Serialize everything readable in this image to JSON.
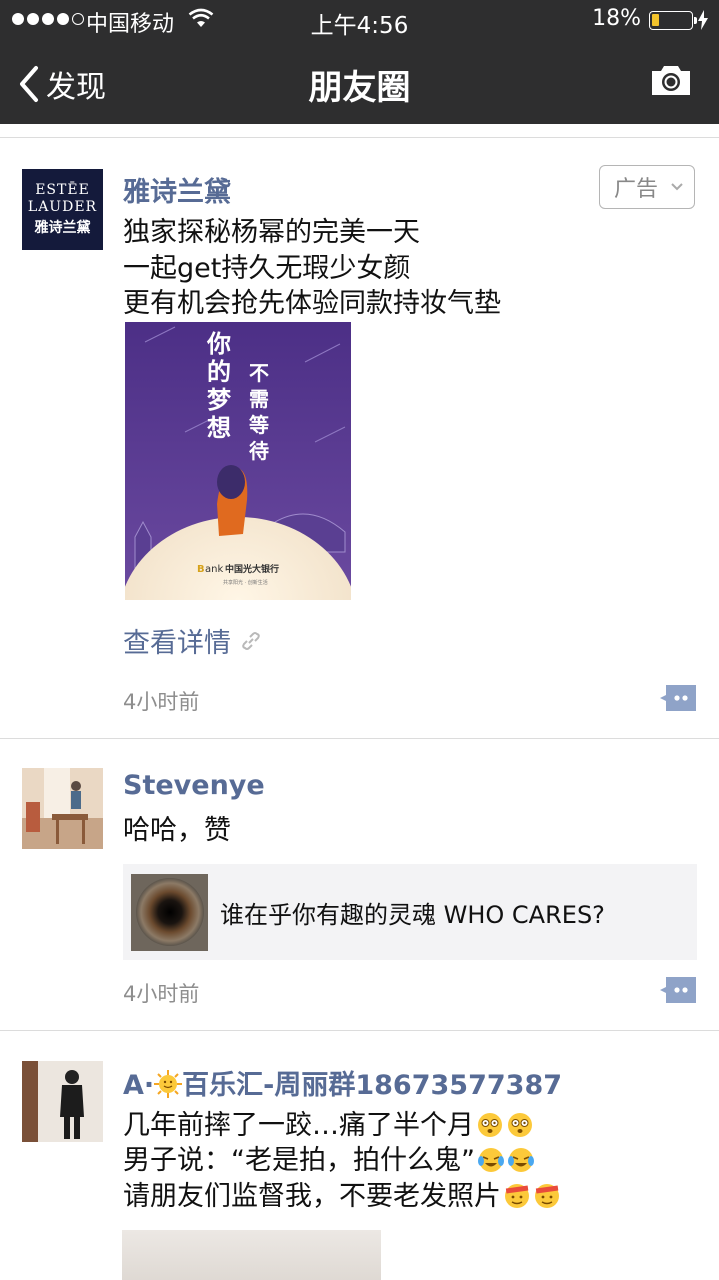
{
  "status_bar": {
    "carrier": "中国移动",
    "time": "上午4:56",
    "battery_percent": "18%",
    "battery_level": 0.18
  },
  "nav": {
    "back_label": "发现",
    "title": "朋友圈"
  },
  "posts": [
    {
      "author": "雅诗兰黛",
      "avatar_text": [
        "ESTĒE",
        "LAUDER",
        "雅诗兰黛"
      ],
      "badge": "广告",
      "lines": [
        "独家探秘杨幂的完美一天",
        "一起get持久无瑕少女颜",
        "更有机会抢先体验同款持妆气垫"
      ],
      "image": {
        "left_text": "你的梦想",
        "right_text": "不需等待",
        "bank_text": "ank",
        "bank_name": "中国光大银行",
        "bank_slogan": "共享阳光 · 创新生活"
      },
      "link_label": "查看详情",
      "time_ago": "4小时前"
    },
    {
      "author": "Stevenye",
      "lines": [
        "哈哈，赞"
      ],
      "share_title": "谁在乎你有趣的灵魂 WHO CARES?",
      "time_ago": "4小时前"
    },
    {
      "author_prefix": "A·",
      "author_suffix": "百乐汇-周丽群18673577387",
      "line1": "几年前摔了一跤…痛了半个月",
      "line2": "男子说：“老是拍，拍什么鬼”",
      "line3": "请朋友们监督我，不要老发照片"
    }
  ],
  "colors": {
    "header_bg": "#2e2e2f",
    "link_blue": "#576b95",
    "ad_purple": "#5b3a8e"
  }
}
